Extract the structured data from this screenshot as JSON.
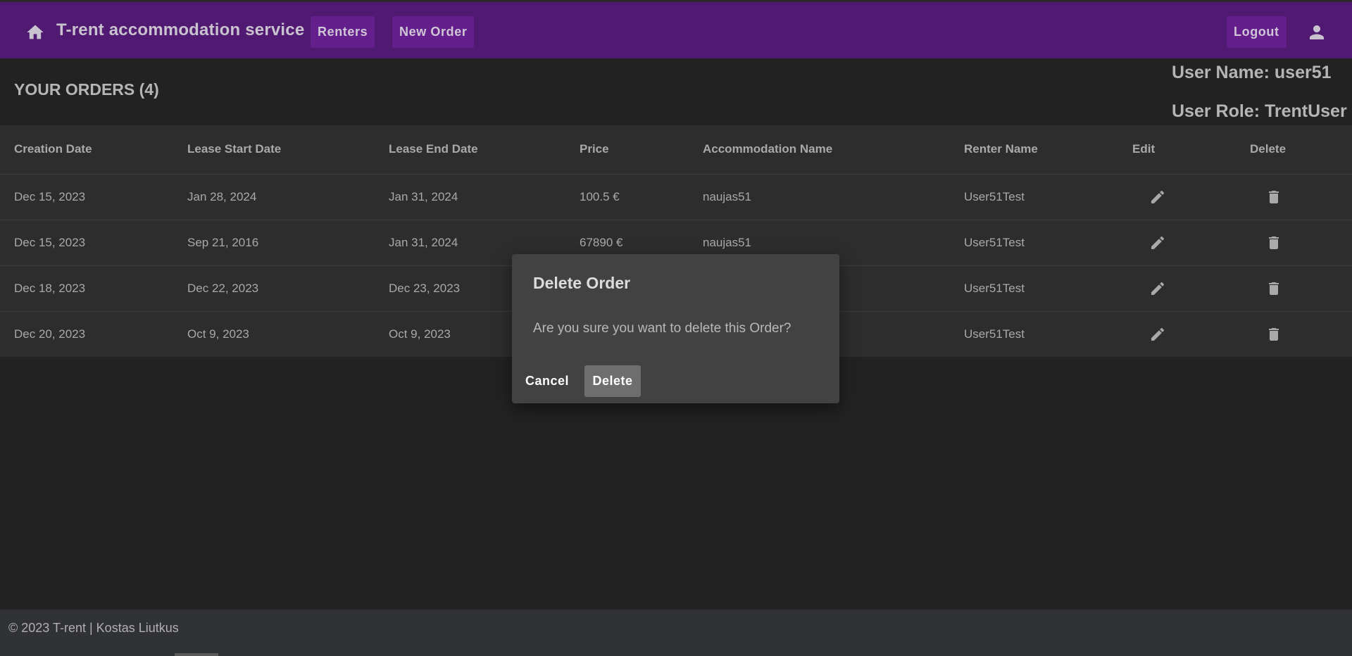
{
  "header": {
    "title": "T-rent accommodation service",
    "home_icon": "home-icon",
    "nav": {
      "renters": "Renters",
      "new_order": "New Order"
    },
    "logout": "Logout",
    "avatar_icon": "account-circle-icon",
    "accent_color": "#511a72"
  },
  "page": {
    "orders_title": "YOUR ORDERS (4)",
    "user_name": "User Name: user51",
    "user_role": "User Role: TrentUser"
  },
  "table": {
    "columns": [
      "Creation Date",
      "Lease Start Date",
      "Lease End Date",
      "Price",
      "Accommodation Name",
      "Renter Name",
      "Edit",
      "Delete"
    ],
    "rows": [
      [
        "Dec 15, 2023",
        "Jan 28, 2024",
        "Jan 31, 2024",
        "100.5 €",
        "naujas51",
        "User51Test"
      ],
      [
        "Dec 15, 2023",
        "Sep 21, 2016",
        "Jan 31, 2024",
        "67890 €",
        "naujas51",
        "User51Test"
      ],
      [
        "Dec 18, 2023",
        "Dec 22, 2023",
        "Dec 23, 2023",
        "",
        "",
        "User51Test"
      ],
      [
        "Dec 20, 2023",
        "Oct 9, 2023",
        "Oct 9, 2023",
        "",
        "",
        "User51Test"
      ]
    ],
    "edit_icon": "pencil-icon",
    "delete_icon": "trash-icon"
  },
  "dialog": {
    "title": "Delete Order",
    "message": "Are you sure you want to delete this Order?",
    "cancel": "Cancel",
    "delete": "Delete"
  },
  "footer": {
    "text": "© 2023 T-rent | Kostas Liutkus"
  }
}
